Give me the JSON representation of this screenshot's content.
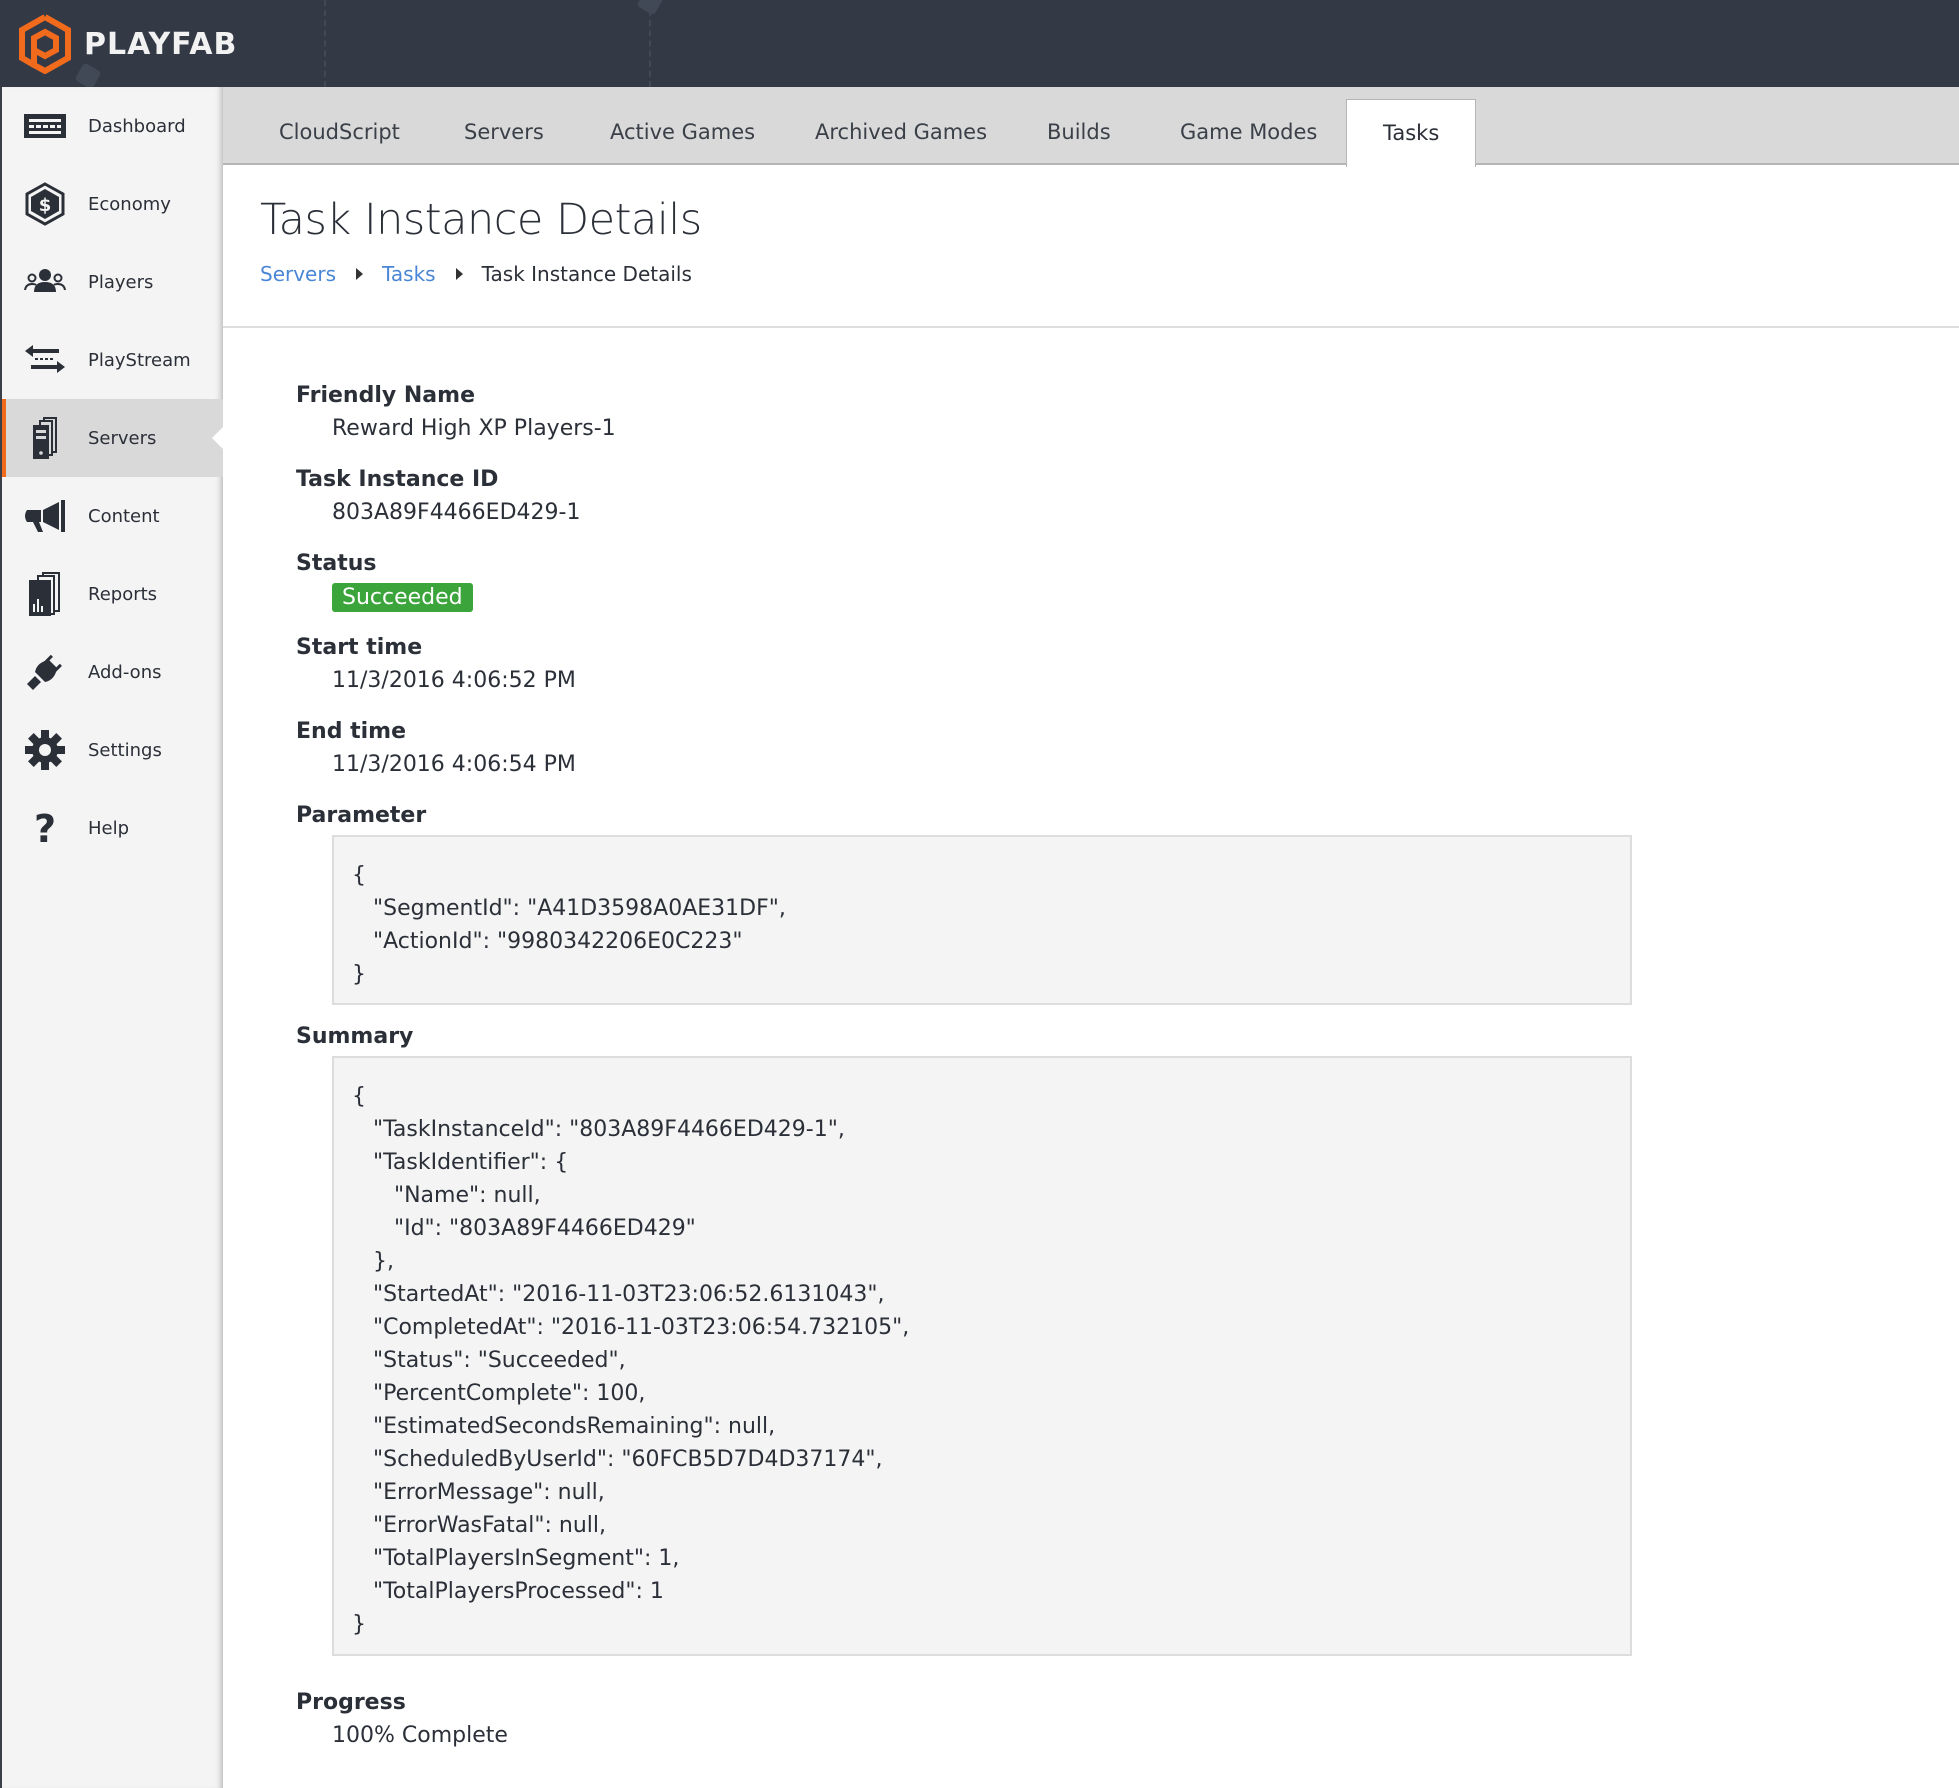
{
  "app": {
    "brand": "PLAYFAB",
    "accent": "#f26b1d",
    "header_bg": "#333a45"
  },
  "sidebar": {
    "items": [
      {
        "label": "Dashboard",
        "icon": "dashboard-icon"
      },
      {
        "label": "Economy",
        "icon": "economy-icon"
      },
      {
        "label": "Players",
        "icon": "players-icon"
      },
      {
        "label": "PlayStream",
        "icon": "playstream-icon"
      },
      {
        "label": "Servers",
        "icon": "servers-icon",
        "active": true
      },
      {
        "label": "Content",
        "icon": "megaphone-icon"
      },
      {
        "label": "Reports",
        "icon": "reports-icon"
      },
      {
        "label": "Add-ons",
        "icon": "plug-icon"
      },
      {
        "label": "Settings",
        "icon": "gear-icon"
      },
      {
        "label": "Help",
        "icon": "help-icon"
      }
    ]
  },
  "tabs": [
    {
      "label": "CloudScript"
    },
    {
      "label": "Servers"
    },
    {
      "label": "Active Games"
    },
    {
      "label": "Archived Games"
    },
    {
      "label": "Builds"
    },
    {
      "label": "Game Modes"
    },
    {
      "label": "Tasks",
      "active": true
    }
  ],
  "page": {
    "title": "Task Instance Details",
    "breadcrumb": [
      {
        "label": "Servers",
        "link": true
      },
      {
        "label": "Tasks",
        "link": true
      },
      {
        "label": "Task Instance Details",
        "link": false
      }
    ]
  },
  "details": {
    "friendly_name_label": "Friendly Name",
    "friendly_name": "Reward High XP Players-1",
    "task_instance_id_label": "Task Instance ID",
    "task_instance_id": "803A89F4466ED429-1",
    "status_label": "Status",
    "status": "Succeeded",
    "status_color": "#3ba43b",
    "start_time_label": "Start time",
    "start_time": "11/3/2016 4:06:52 PM",
    "end_time_label": "End time",
    "end_time": "11/3/2016 4:06:54 PM",
    "parameter_label": "Parameter",
    "parameter_lines": [
      "{",
      "   \"SegmentId\": \"A41D3598A0AE31DF\",",
      "   \"ActionId\": \"9980342206E0C223\"",
      "}"
    ],
    "summary_label": "Summary",
    "summary_lines": [
      "{",
      "   \"TaskInstanceId\": \"803A89F4466ED429-1\",",
      "   \"TaskIdentifier\": {",
      "      \"Name\": null,",
      "      \"Id\": \"803A89F4466ED429\"",
      "   },",
      "   \"StartedAt\": \"2016-11-03T23:06:52.6131043\",",
      "   \"CompletedAt\": \"2016-11-03T23:06:54.732105\",",
      "   \"Status\": \"Succeeded\",",
      "   \"PercentComplete\": 100,",
      "   \"EstimatedSecondsRemaining\": null,",
      "   \"ScheduledByUserId\": \"60FCB5D7D4D37174\",",
      "   \"ErrorMessage\": null,",
      "   \"ErrorWasFatal\": null,",
      "   \"TotalPlayersInSegment\": 1,",
      "   \"TotalPlayersProcessed\": 1",
      "}"
    ],
    "progress_label": "Progress",
    "progress": "100% Complete"
  }
}
